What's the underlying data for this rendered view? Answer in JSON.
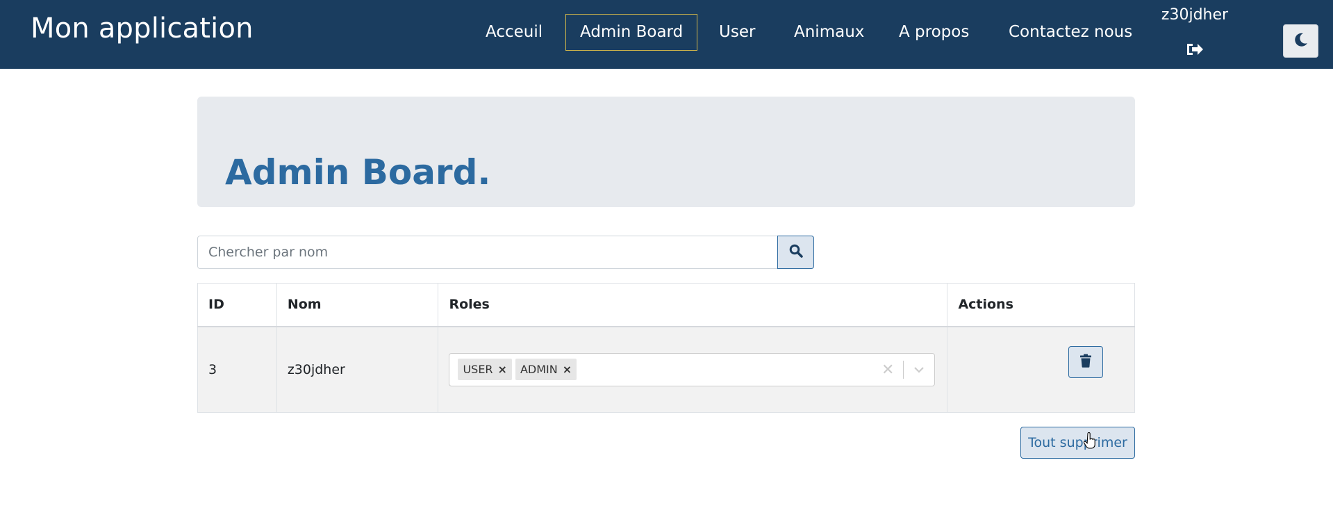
{
  "navbar": {
    "brand": "Mon application",
    "links": [
      {
        "label": "Acceuil",
        "active": false
      },
      {
        "label": "Admin Board",
        "active": true
      },
      {
        "label": "User",
        "active": false
      },
      {
        "label": "Animaux",
        "active": false
      },
      {
        "label": "A propos",
        "active": false
      },
      {
        "label": "Contactez nous",
        "active": false
      }
    ],
    "username": "z30jdher",
    "logout_icon": "sign-out-icon",
    "theme_icon": "moon-icon"
  },
  "jumbotron": {
    "title": "Admin Board."
  },
  "search": {
    "placeholder": "Chercher par nom",
    "value": "",
    "icon": "search-icon"
  },
  "table": {
    "headers": [
      "ID",
      "Nom",
      "Roles",
      "Actions"
    ],
    "rows": [
      {
        "id": "3",
        "nom": "z30jdher",
        "roles": [
          "USER",
          "ADMIN"
        ],
        "action_icon": "trash-icon"
      }
    ]
  },
  "actions": {
    "delete_all_label": "Tout supprimer"
  },
  "colors": {
    "navbar_bg": "#1a3d5f",
    "accent": "#2c6aa0",
    "active_border": "#d4b84a",
    "jumbotron_bg": "#e7eaee"
  }
}
